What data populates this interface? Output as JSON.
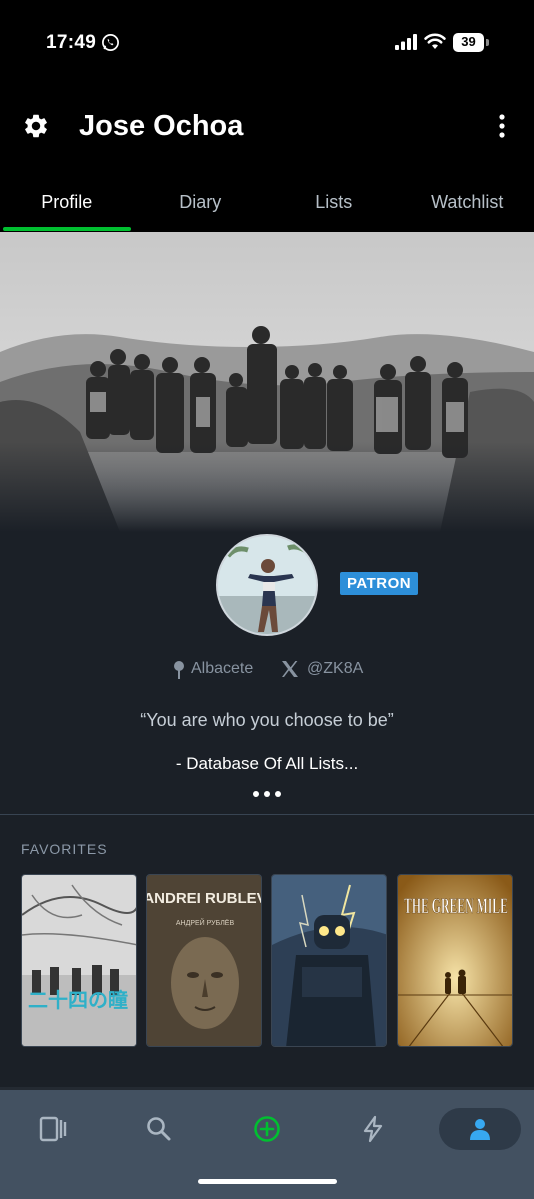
{
  "status_bar": {
    "time": "17:49",
    "battery": "39"
  },
  "header": {
    "username": "Jose Ochoa"
  },
  "tabs": [
    {
      "label": "Profile",
      "active": true
    },
    {
      "label": "Diary",
      "active": false
    },
    {
      "label": "Lists",
      "active": false
    },
    {
      "label": "Watchlist",
      "active": false
    }
  ],
  "profile": {
    "badge": "PATRON",
    "location": "Albacete",
    "twitter": "@ZK8A",
    "bio": "“You are who you choose to be”",
    "bio_line2": "- Database Of All Lists..."
  },
  "favorites": {
    "title": "FAVORITES",
    "films": [
      {
        "poster_text": "二十四の瞳"
      },
      {
        "poster_title": "ANDREI RUBLEV",
        "poster_subtitle": "АНДРЕЙ РУБЛЁВ"
      },
      {
        "poster_title": ""
      },
      {
        "poster_title": "THE GREEN MILE"
      }
    ]
  },
  "nav": {
    "items": [
      "films-icon",
      "search-icon",
      "add-icon",
      "activity-icon",
      "profile-icon"
    ],
    "active": "profile-icon"
  },
  "colors": {
    "accent_green": "#00c030",
    "patron_blue": "#2d8fd9",
    "bg": "#1b2027",
    "nav_bg": "#435161"
  }
}
